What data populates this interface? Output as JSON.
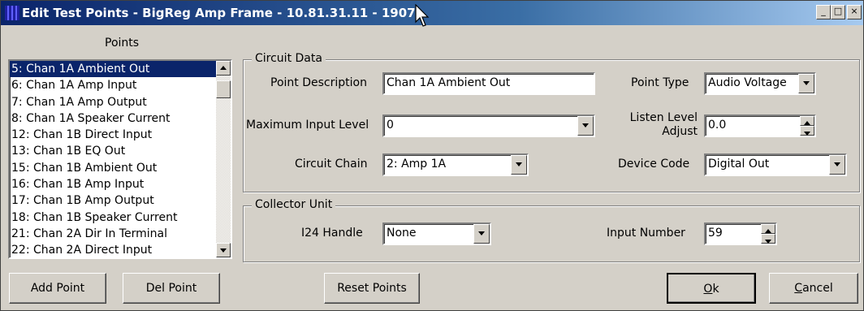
{
  "window": {
    "title": "Edit Test Points - BigReg Amp Frame - 10.81.31.11 - 1907",
    "minimize": "_",
    "maximize": "□",
    "close": "×"
  },
  "points": {
    "label": "Points",
    "items": [
      "5: Chan 1A Ambient Out",
      "6: Chan 1A Amp Input",
      "7: Chan 1A Amp Output",
      "8: Chan 1A Speaker Current",
      "12: Chan 1B Direct Input",
      "13: Chan 1B EQ Out",
      "15: Chan 1B Ambient Out",
      "16: Chan 1B Amp Input",
      "17: Chan 1B Amp Output",
      "18: Chan 1B Speaker Current",
      "21: Chan 2A Dir In Terminal",
      "22: Chan 2A Direct Input"
    ],
    "selected_index": 0
  },
  "circuit_data": {
    "group_title": "Circuit Data",
    "point_description_label": "Point Description",
    "point_description_value": "Chan 1A Ambient Out",
    "point_type_label": "Point Type",
    "point_type_value": "Audio Voltage",
    "max_input_level_label": "Maximum Input Level",
    "max_input_level_value": "0",
    "listen_level_label_line1": "Listen Level",
    "listen_level_label_line2": "Adjust",
    "listen_level_value": "0.0",
    "circuit_chain_label": "Circuit Chain",
    "circuit_chain_value": "2: Amp 1A",
    "device_code_label": "Device Code",
    "device_code_value": "Digital Out"
  },
  "collector_unit": {
    "group_title": "Collector Unit",
    "i24_handle_label": "I24 Handle",
    "i24_handle_value": "None",
    "input_number_label": "Input Number",
    "input_number_value": "59"
  },
  "buttons": {
    "add_point": "Add Point",
    "del_point": "Del Point",
    "reset_points": "Reset Points",
    "ok_accel": "O",
    "ok_rest": "k",
    "cancel_accel": "C",
    "cancel_rest": "ancel"
  }
}
